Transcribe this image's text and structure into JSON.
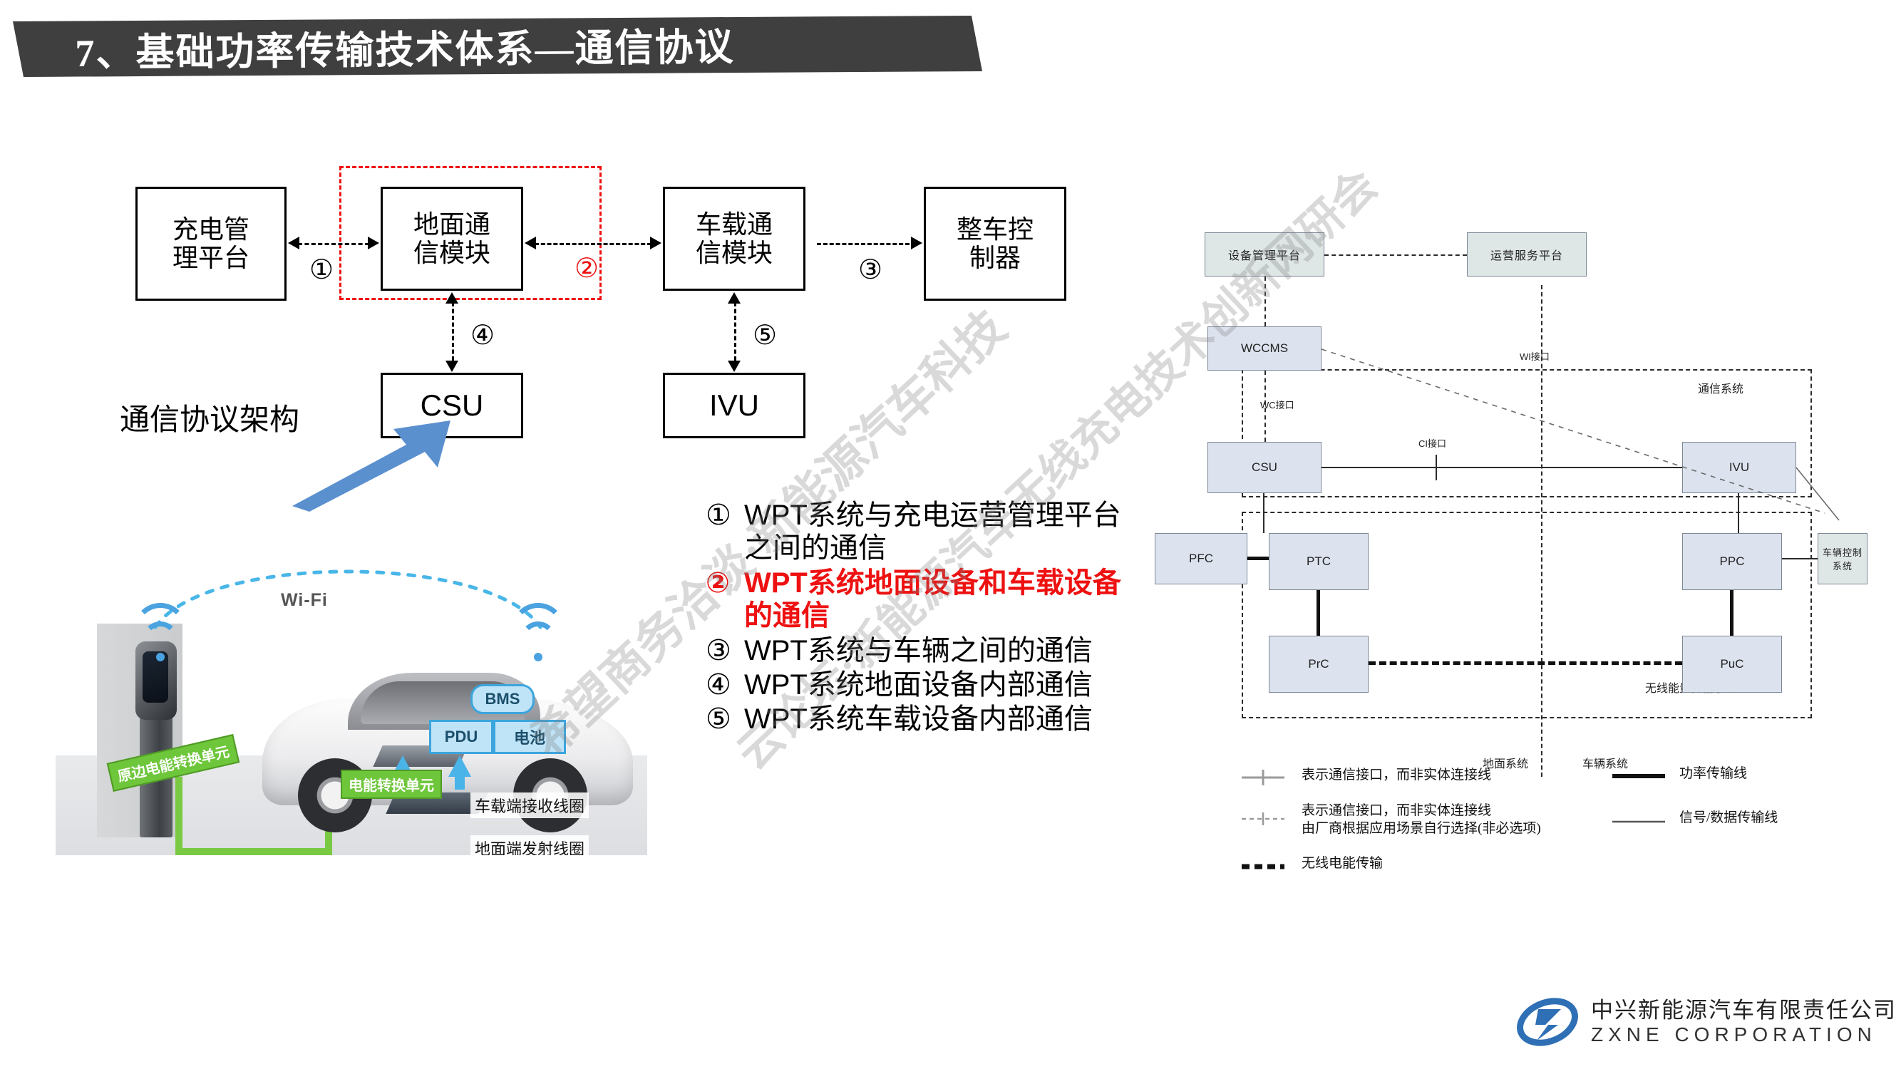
{
  "slide": {
    "title": "7、基础功率传输技术体系—通信协议",
    "title_color": "#3f3f3f"
  },
  "protocol_diagram": {
    "caption": "通信协议架构",
    "boxes": {
      "charge_platform": "充电管\n理平台",
      "ground_comm": "地面通\n信模块",
      "vehicle_comm": "车载通\n信模块",
      "vcu": "整车控\n制器",
      "csu": "CSU",
      "ivu": "IVU"
    },
    "markers": {
      "m1": "①",
      "m2": "②",
      "m3": "③",
      "m4": "④",
      "m5": "⑤"
    },
    "highlight_color": "#ee1111"
  },
  "notes": [
    {
      "mark": "①",
      "text": "WPT系统与充电运营管理平台之间的通信",
      "highlight": false
    },
    {
      "mark": "②",
      "text": "WPT系统地面设备和车载设备的通信",
      "highlight": true
    },
    {
      "mark": "③",
      "text": "WPT系统与车辆之间的通信",
      "highlight": false
    },
    {
      "mark": "④",
      "text": "WPT系统地面设备内部通信",
      "highlight": false
    },
    {
      "mark": "⑤",
      "text": "WPT系统车载设备内部通信",
      "highlight": false
    }
  ],
  "photo": {
    "wifi_label": "Wi-Fi",
    "labels": {
      "primary_unit": "原边电能转换单元",
      "energy_unit": "电能转换单元",
      "vehicle_coil": "车载端接收线圈",
      "ground_coil": "地面端发射线圈",
      "bms": "BMS",
      "pdu": "PDU",
      "battery": "电池"
    }
  },
  "architecture": {
    "boxes": {
      "device_platform": "设备管理平台",
      "operation_platform": "运营服务平台",
      "wccms": "WCCMS",
      "csu": "CSU",
      "ivu": "IVU",
      "pfc": "PFC",
      "ptc": "PTC",
      "prc": "PrC",
      "ppc": "PPC",
      "puc": "PuC",
      "vehicle_control": "车辆控制系统"
    },
    "interfaces": {
      "wi": "WI接口",
      "wc": "WC接口",
      "ci": "CI接口"
    },
    "groups": {
      "comm_system": "通信系统",
      "wpt_system": "无线能量传输系统WPT",
      "ground_system": "地面系统",
      "vehicle_system": "车辆系统"
    }
  },
  "legend": [
    {
      "style": "cross-solid",
      "text": "表示通信接口，而非实体连接线"
    },
    {
      "style": "cross-dashed",
      "text": "表示通信接口，而非实体连接线\n由厂商根据应用场景自行选择(非必选项)"
    },
    {
      "style": "thick-dashed",
      "text": "无线电能传输"
    },
    {
      "style": "thick-solid",
      "text": "功率传输线"
    },
    {
      "style": "thin-solid",
      "text": "信号/数据传输线"
    }
  ],
  "watermarks": [
    "希望商务洽谈·新能源汽车科技",
    "云论坛·新能源汽车无线充电技术创新网研会"
  ],
  "footer": {
    "company_cn": "中兴新能源汽车有限责任公司",
    "company_en": "ZXNE CORPORATION",
    "brand_color": "#2f6fb5"
  }
}
